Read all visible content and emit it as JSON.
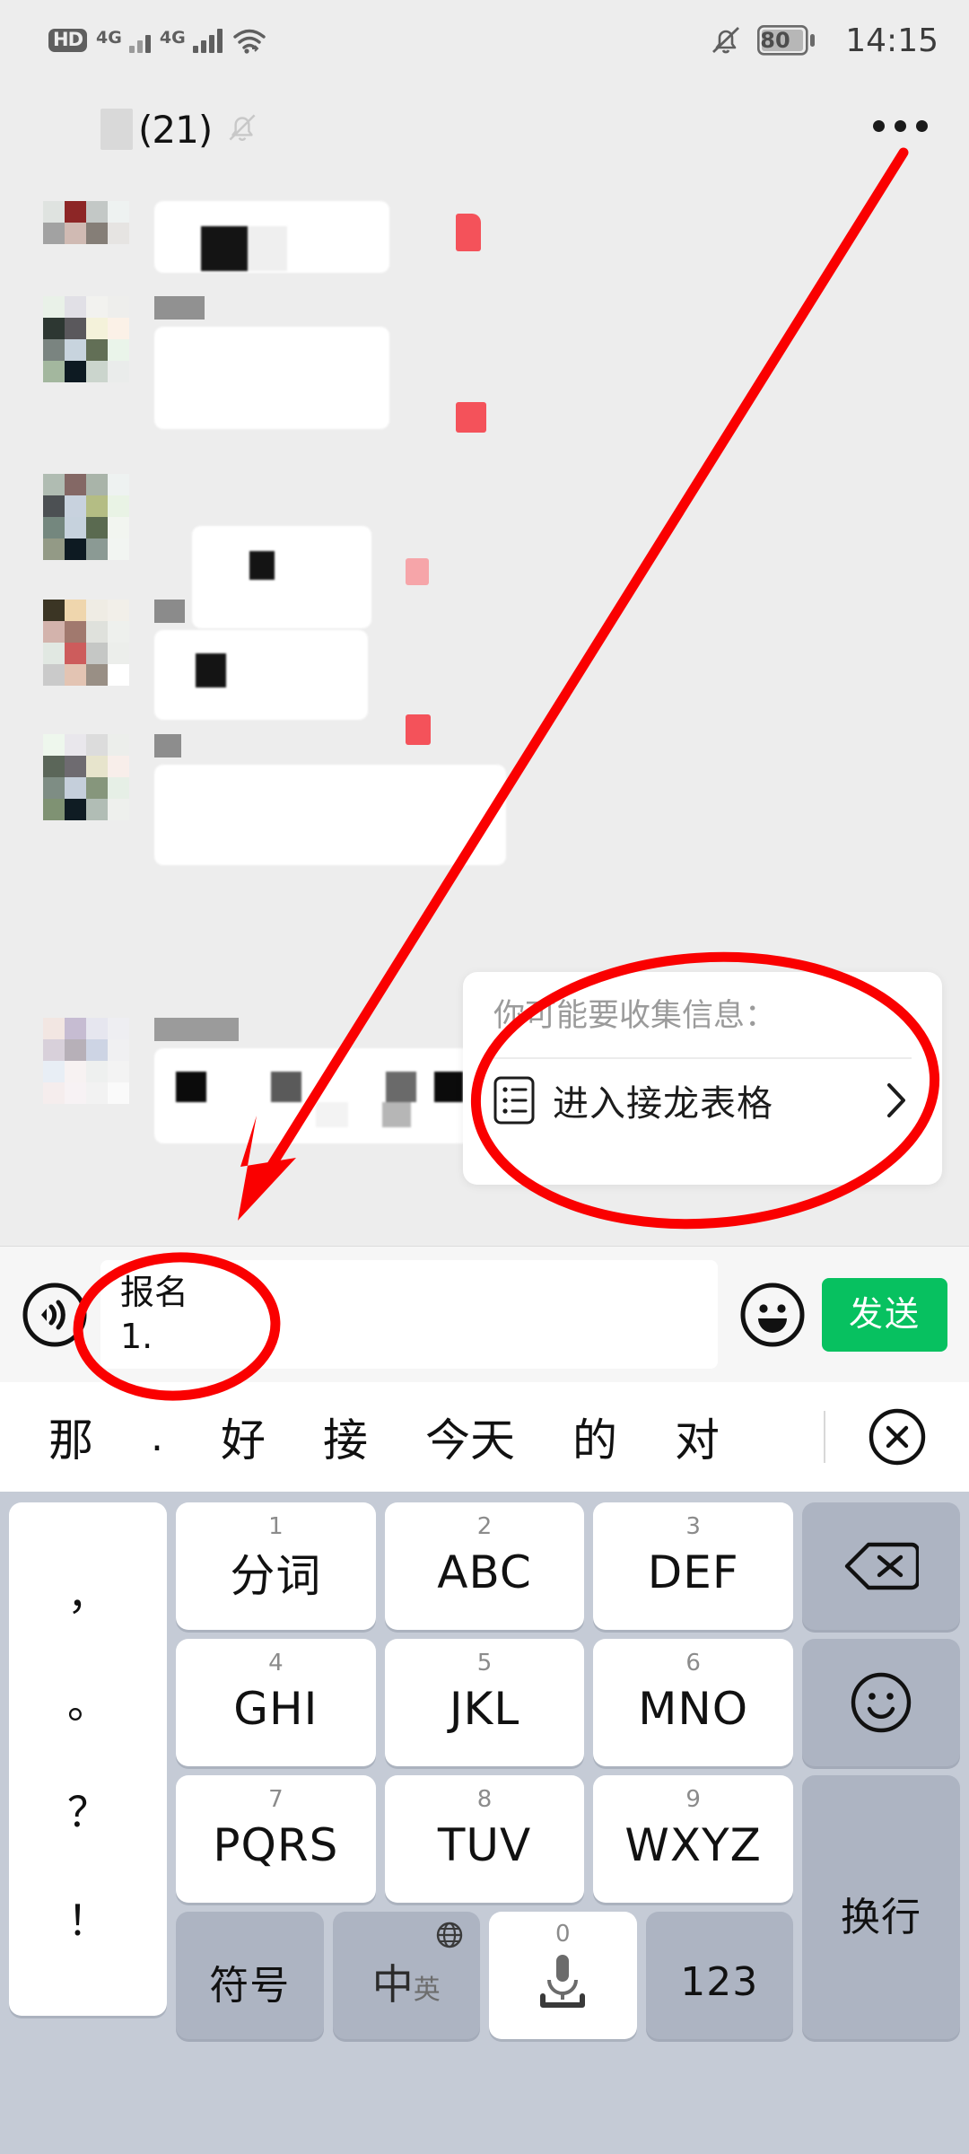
{
  "status_bar": {
    "hd_label": "HD",
    "network_1": "4G",
    "network_2": "4G",
    "battery_level": "80",
    "time": "14:15",
    "icons": [
      "hd-icon",
      "signal-4g-icon",
      "signal-4g-icon",
      "wifi-icon",
      "bell-muted-icon",
      "battery-icon"
    ]
  },
  "chat_header": {
    "member_count": "(21)",
    "bell_icon": "bell-muted-icon",
    "more_icon": "more-options-icon"
  },
  "messages": [
    {
      "id": 1,
      "sender_redacted": true,
      "has_red_badge": true
    },
    {
      "id": 2,
      "sender_redacted": true,
      "has_red_badge": true
    },
    {
      "id": 3,
      "sender_redacted": true,
      "has_red_badge": true
    },
    {
      "id": 4,
      "sender_redacted": true,
      "has_red_badge": true
    },
    {
      "id": 5,
      "sender_redacted": true,
      "has_red_badge": false
    },
    {
      "id": 6,
      "sender_redacted": true,
      "has_red_badge": false
    }
  ],
  "tool_card": {
    "title": "你可能要收集信息：",
    "action_label": "进入接龙表格",
    "list_icon": "list-form-icon",
    "chevron_icon": "chevron-right-icon"
  },
  "input_bar": {
    "voice_icon": "voice-input-icon",
    "text_line_1": "报名",
    "text_line_2": "1.",
    "emoji_icon": "emoji-smile-icon",
    "send_label": "发送",
    "send_color": "#07c160"
  },
  "candidate_bar": {
    "candidates": [
      "那",
      ".",
      "好",
      "接",
      "今天",
      "的",
      "对"
    ],
    "close_icon": "close-circle-icon"
  },
  "keyboard": {
    "punct_column": [
      "，",
      "。",
      "？",
      "！"
    ],
    "rows": [
      [
        {
          "num": "1",
          "label": "分词"
        },
        {
          "num": "2",
          "label": "ABC"
        },
        {
          "num": "3",
          "label": "DEF"
        }
      ],
      [
        {
          "num": "4",
          "label": "GHI"
        },
        {
          "num": "5",
          "label": "JKL"
        },
        {
          "num": "6",
          "label": "MNO"
        }
      ],
      [
        {
          "num": "7",
          "label": "PQRS"
        },
        {
          "num": "8",
          "label": "TUV"
        },
        {
          "num": "9",
          "label": "WXYZ"
        }
      ]
    ],
    "bottom_row": {
      "symbols_label": "符号",
      "lang_label": "中",
      "lang_sub": "英",
      "globe_icon": "globe-icon",
      "space_num": "0",
      "mic_icon": "microphone-icon",
      "numeric_label": "123"
    },
    "right_column": {
      "backspace_icon": "backspace-icon",
      "emoji_icon": "emoji-smile-icon",
      "enter_label": "换行"
    }
  },
  "annotations": {
    "color": "#fa0000",
    "ellipse_tool_card": "highlight-ellipse-tool-card",
    "ellipse_input_text": "highlight-ellipse-input-text",
    "arrow": "annotation-arrow"
  }
}
